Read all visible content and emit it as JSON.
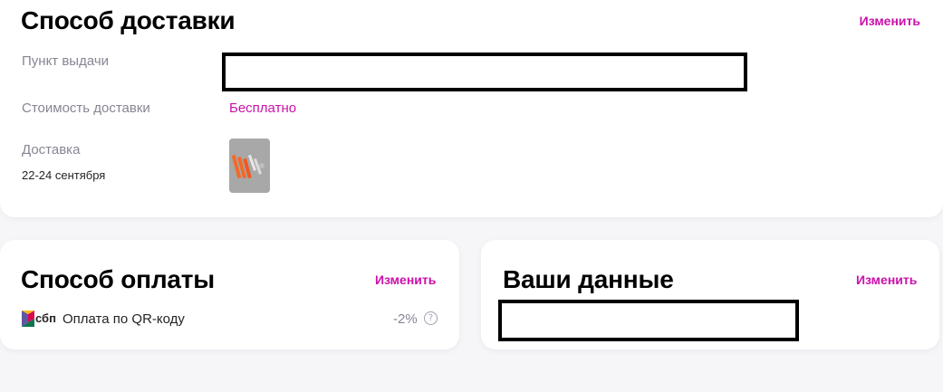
{
  "delivery": {
    "title": "Способ доставки",
    "change_label": "Изменить",
    "pickup_label": "Пункт выдачи",
    "cost_label": "Стоимость доставки",
    "cost_value": "Бесплатно",
    "delivery_label": "Доставка",
    "delivery_dates": "22-24 сентября"
  },
  "payment": {
    "title": "Способ оплаты",
    "change_label": "Изменить",
    "method_logo": "сбп",
    "method_label": "Оплата по QR-коду",
    "discount": "-2%",
    "help_glyph": "?"
  },
  "user": {
    "title": "Ваши данные",
    "change_label": "Изменить"
  },
  "colors": {
    "accent": "#cb11ab",
    "muted": "#868695",
    "background": "#f6f6f9"
  }
}
